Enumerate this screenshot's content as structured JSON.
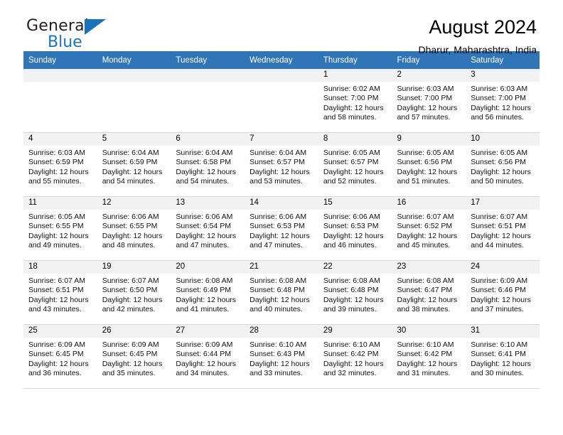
{
  "brand": {
    "name_part1": "General",
    "name_part2": "Blue",
    "logo_icon": "triangle-logo-icon"
  },
  "header": {
    "title": "August 2024",
    "subtitle": "Dharur, Maharashtra, India"
  },
  "calendar": {
    "weekday_headers": [
      "Sunday",
      "Monday",
      "Tuesday",
      "Wednesday",
      "Thursday",
      "Friday",
      "Saturday"
    ],
    "accent_color": "#3075b7",
    "daynum_bg": "#f2f2f2",
    "weeks": [
      [
        {
          "day": "",
          "blank": true,
          "sunrise": "",
          "sunset": "",
          "daylight_1": "",
          "daylight_2": ""
        },
        {
          "day": "",
          "blank": true,
          "sunrise": "",
          "sunset": "",
          "daylight_1": "",
          "daylight_2": ""
        },
        {
          "day": "",
          "blank": true,
          "sunrise": "",
          "sunset": "",
          "daylight_1": "",
          "daylight_2": ""
        },
        {
          "day": "",
          "blank": true,
          "sunrise": "",
          "sunset": "",
          "daylight_1": "",
          "daylight_2": ""
        },
        {
          "day": "1",
          "blank": false,
          "sunrise": "Sunrise: 6:02 AM",
          "sunset": "Sunset: 7:00 PM",
          "daylight_1": "Daylight: 12 hours",
          "daylight_2": "and 58 minutes."
        },
        {
          "day": "2",
          "blank": false,
          "sunrise": "Sunrise: 6:03 AM",
          "sunset": "Sunset: 7:00 PM",
          "daylight_1": "Daylight: 12 hours",
          "daylight_2": "and 57 minutes."
        },
        {
          "day": "3",
          "blank": false,
          "sunrise": "Sunrise: 6:03 AM",
          "sunset": "Sunset: 7:00 PM",
          "daylight_1": "Daylight: 12 hours",
          "daylight_2": "and 56 minutes."
        }
      ],
      [
        {
          "day": "4",
          "blank": false,
          "sunrise": "Sunrise: 6:03 AM",
          "sunset": "Sunset: 6:59 PM",
          "daylight_1": "Daylight: 12 hours",
          "daylight_2": "and 55 minutes."
        },
        {
          "day": "5",
          "blank": false,
          "sunrise": "Sunrise: 6:04 AM",
          "sunset": "Sunset: 6:59 PM",
          "daylight_1": "Daylight: 12 hours",
          "daylight_2": "and 54 minutes."
        },
        {
          "day": "6",
          "blank": false,
          "sunrise": "Sunrise: 6:04 AM",
          "sunset": "Sunset: 6:58 PM",
          "daylight_1": "Daylight: 12 hours",
          "daylight_2": "and 54 minutes."
        },
        {
          "day": "7",
          "blank": false,
          "sunrise": "Sunrise: 6:04 AM",
          "sunset": "Sunset: 6:57 PM",
          "daylight_1": "Daylight: 12 hours",
          "daylight_2": "and 53 minutes."
        },
        {
          "day": "8",
          "blank": false,
          "sunrise": "Sunrise: 6:05 AM",
          "sunset": "Sunset: 6:57 PM",
          "daylight_1": "Daylight: 12 hours",
          "daylight_2": "and 52 minutes."
        },
        {
          "day": "9",
          "blank": false,
          "sunrise": "Sunrise: 6:05 AM",
          "sunset": "Sunset: 6:56 PM",
          "daylight_1": "Daylight: 12 hours",
          "daylight_2": "and 51 minutes."
        },
        {
          "day": "10",
          "blank": false,
          "sunrise": "Sunrise: 6:05 AM",
          "sunset": "Sunset: 6:56 PM",
          "daylight_1": "Daylight: 12 hours",
          "daylight_2": "and 50 minutes."
        }
      ],
      [
        {
          "day": "11",
          "blank": false,
          "sunrise": "Sunrise: 6:05 AM",
          "sunset": "Sunset: 6:55 PM",
          "daylight_1": "Daylight: 12 hours",
          "daylight_2": "and 49 minutes."
        },
        {
          "day": "12",
          "blank": false,
          "sunrise": "Sunrise: 6:06 AM",
          "sunset": "Sunset: 6:55 PM",
          "daylight_1": "Daylight: 12 hours",
          "daylight_2": "and 48 minutes."
        },
        {
          "day": "13",
          "blank": false,
          "sunrise": "Sunrise: 6:06 AM",
          "sunset": "Sunset: 6:54 PM",
          "daylight_1": "Daylight: 12 hours",
          "daylight_2": "and 47 minutes."
        },
        {
          "day": "14",
          "blank": false,
          "sunrise": "Sunrise: 6:06 AM",
          "sunset": "Sunset: 6:53 PM",
          "daylight_1": "Daylight: 12 hours",
          "daylight_2": "and 47 minutes."
        },
        {
          "day": "15",
          "blank": false,
          "sunrise": "Sunrise: 6:06 AM",
          "sunset": "Sunset: 6:53 PM",
          "daylight_1": "Daylight: 12 hours",
          "daylight_2": "and 46 minutes."
        },
        {
          "day": "16",
          "blank": false,
          "sunrise": "Sunrise: 6:07 AM",
          "sunset": "Sunset: 6:52 PM",
          "daylight_1": "Daylight: 12 hours",
          "daylight_2": "and 45 minutes."
        },
        {
          "day": "17",
          "blank": false,
          "sunrise": "Sunrise: 6:07 AM",
          "sunset": "Sunset: 6:51 PM",
          "daylight_1": "Daylight: 12 hours",
          "daylight_2": "and 44 minutes."
        }
      ],
      [
        {
          "day": "18",
          "blank": false,
          "sunrise": "Sunrise: 6:07 AM",
          "sunset": "Sunset: 6:51 PM",
          "daylight_1": "Daylight: 12 hours",
          "daylight_2": "and 43 minutes."
        },
        {
          "day": "19",
          "blank": false,
          "sunrise": "Sunrise: 6:07 AM",
          "sunset": "Sunset: 6:50 PM",
          "daylight_1": "Daylight: 12 hours",
          "daylight_2": "and 42 minutes."
        },
        {
          "day": "20",
          "blank": false,
          "sunrise": "Sunrise: 6:08 AM",
          "sunset": "Sunset: 6:49 PM",
          "daylight_1": "Daylight: 12 hours",
          "daylight_2": "and 41 minutes."
        },
        {
          "day": "21",
          "blank": false,
          "sunrise": "Sunrise: 6:08 AM",
          "sunset": "Sunset: 6:48 PM",
          "daylight_1": "Daylight: 12 hours",
          "daylight_2": "and 40 minutes."
        },
        {
          "day": "22",
          "blank": false,
          "sunrise": "Sunrise: 6:08 AM",
          "sunset": "Sunset: 6:48 PM",
          "daylight_1": "Daylight: 12 hours",
          "daylight_2": "and 39 minutes."
        },
        {
          "day": "23",
          "blank": false,
          "sunrise": "Sunrise: 6:08 AM",
          "sunset": "Sunset: 6:47 PM",
          "daylight_1": "Daylight: 12 hours",
          "daylight_2": "and 38 minutes."
        },
        {
          "day": "24",
          "blank": false,
          "sunrise": "Sunrise: 6:09 AM",
          "sunset": "Sunset: 6:46 PM",
          "daylight_1": "Daylight: 12 hours",
          "daylight_2": "and 37 minutes."
        }
      ],
      [
        {
          "day": "25",
          "blank": false,
          "sunrise": "Sunrise: 6:09 AM",
          "sunset": "Sunset: 6:45 PM",
          "daylight_1": "Daylight: 12 hours",
          "daylight_2": "and 36 minutes."
        },
        {
          "day": "26",
          "blank": false,
          "sunrise": "Sunrise: 6:09 AM",
          "sunset": "Sunset: 6:45 PM",
          "daylight_1": "Daylight: 12 hours",
          "daylight_2": "and 35 minutes."
        },
        {
          "day": "27",
          "blank": false,
          "sunrise": "Sunrise: 6:09 AM",
          "sunset": "Sunset: 6:44 PM",
          "daylight_1": "Daylight: 12 hours",
          "daylight_2": "and 34 minutes."
        },
        {
          "day": "28",
          "blank": false,
          "sunrise": "Sunrise: 6:10 AM",
          "sunset": "Sunset: 6:43 PM",
          "daylight_1": "Daylight: 12 hours",
          "daylight_2": "and 33 minutes."
        },
        {
          "day": "29",
          "blank": false,
          "sunrise": "Sunrise: 6:10 AM",
          "sunset": "Sunset: 6:42 PM",
          "daylight_1": "Daylight: 12 hours",
          "daylight_2": "and 32 minutes."
        },
        {
          "day": "30",
          "blank": false,
          "sunrise": "Sunrise: 6:10 AM",
          "sunset": "Sunset: 6:42 PM",
          "daylight_1": "Daylight: 12 hours",
          "daylight_2": "and 31 minutes."
        },
        {
          "day": "31",
          "blank": false,
          "sunrise": "Sunrise: 6:10 AM",
          "sunset": "Sunset: 6:41 PM",
          "daylight_1": "Daylight: 12 hours",
          "daylight_2": "and 30 minutes."
        }
      ]
    ]
  }
}
